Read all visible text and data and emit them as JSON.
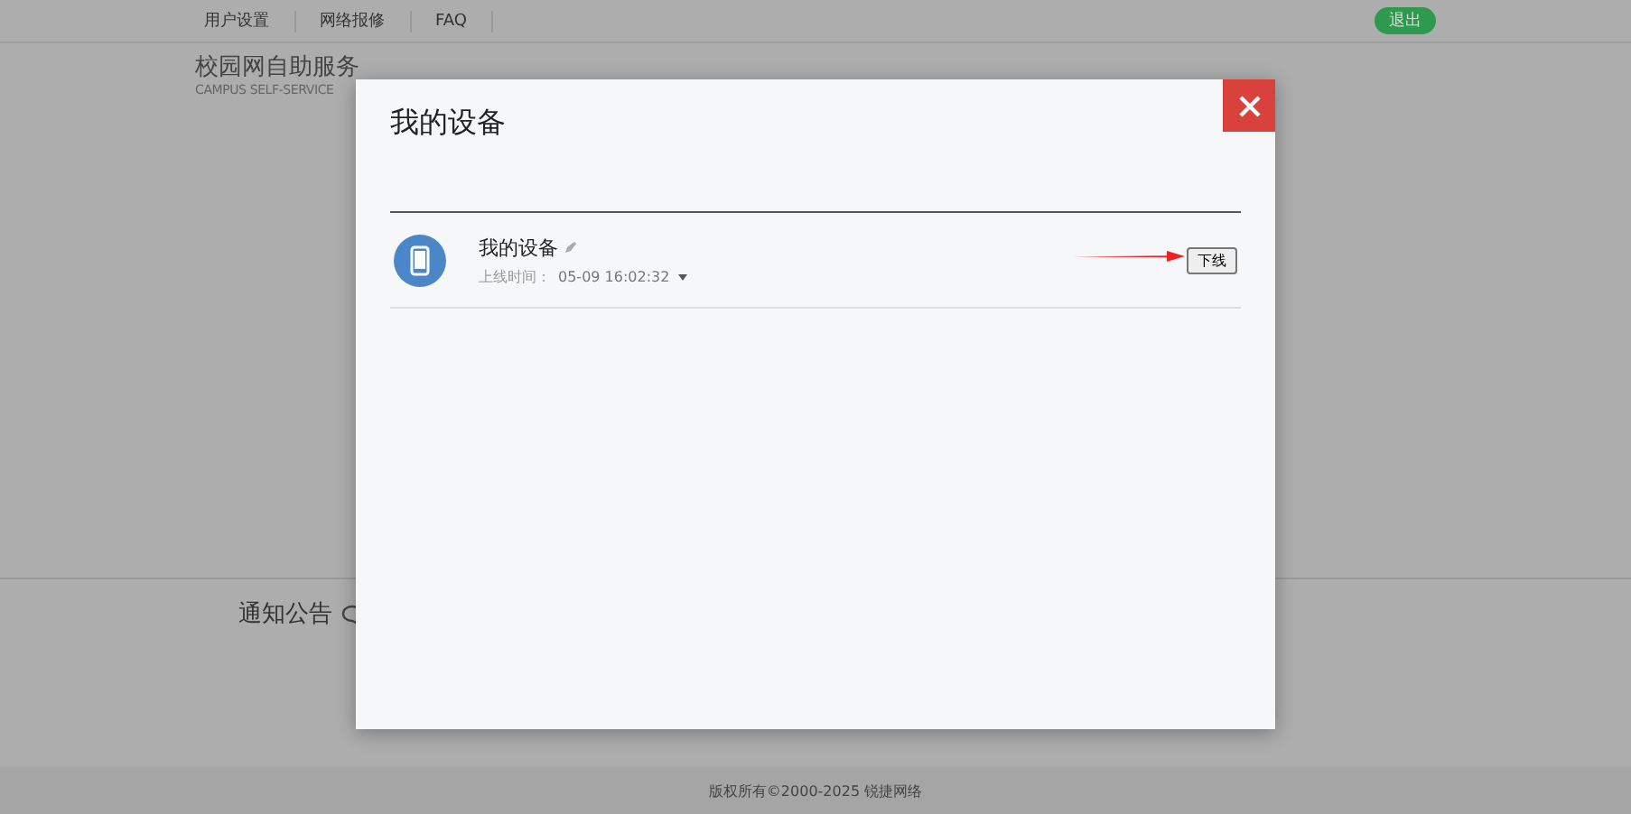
{
  "nav": {
    "items": [
      "用户设置",
      "网络报修",
      "FAQ"
    ],
    "logout": "退出"
  },
  "header": {
    "title": "校园网自助服务",
    "subtitle": "CAMPUS SELF-SERVICE"
  },
  "notice": {
    "title": "通知公告"
  },
  "footer": "版权所有©2000-2025 锐捷网络",
  "modal": {
    "title": "我的设备",
    "devices": [
      {
        "name": "我的设备",
        "time_label": "上线时间：",
        "time": "05-09 16:02:32",
        "action": "下线"
      }
    ]
  }
}
